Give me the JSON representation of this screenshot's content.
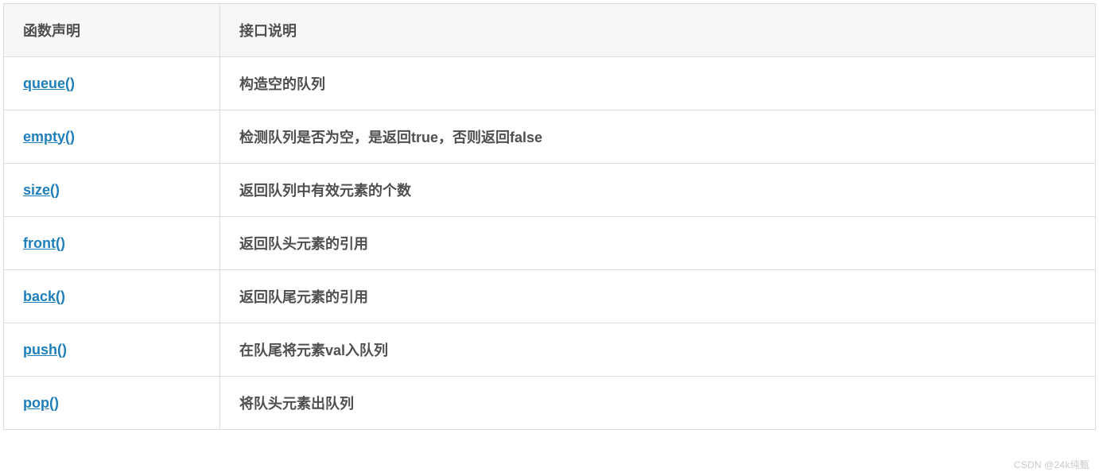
{
  "table": {
    "headers": {
      "func": "函数声明",
      "desc": "接口说明"
    },
    "rows": [
      {
        "func": "queue()",
        "desc": "构造空的队列"
      },
      {
        "func": "empty()",
        "desc": "检测队列是否为空，是返回true，否则返回false"
      },
      {
        "func": "size()",
        "desc": "返回队列中有效元素的个数"
      },
      {
        "func": "front()",
        "desc": "返回队头元素的引用"
      },
      {
        "func": "back()",
        "desc": "返回队尾元素的引用"
      },
      {
        "func": "push()",
        "desc": "在队尾将元素val入队列"
      },
      {
        "func": "pop()",
        "desc": "将队头元素出队列"
      }
    ]
  },
  "watermark": "CSDN @24k纯甄"
}
